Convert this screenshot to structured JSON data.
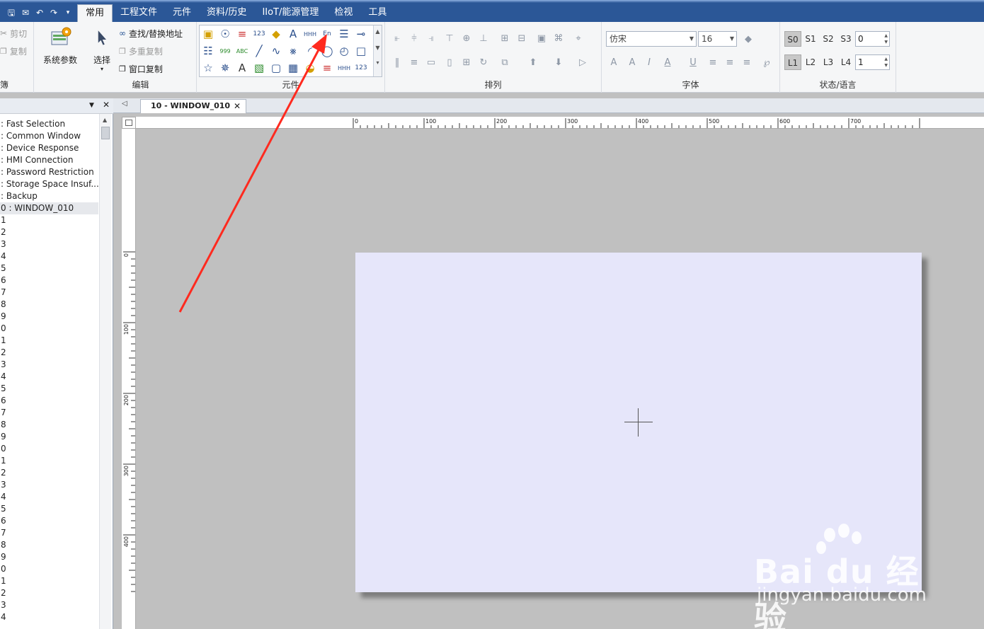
{
  "menu": {
    "tabs": [
      "常用",
      "工程文件",
      "元件",
      "资料/历史",
      "IIoT/能源管理",
      "检视",
      "工具"
    ],
    "active_index": 0
  },
  "ribbon": {
    "clipboard": {
      "cut": "剪切",
      "copy": "复制",
      "label": "簿"
    },
    "system_params": "系统参数",
    "select": "选择",
    "edit": {
      "find_replace": "查找/替换地址",
      "multi_copy": "多重复制",
      "window_copy": "窗口复制",
      "label": "编辑"
    },
    "elements_label": "元件",
    "arrange_label": "排列",
    "font": {
      "name": "仿宋",
      "size": "16",
      "label": "字体"
    },
    "state_lang": {
      "states": [
        "S0",
        "S1",
        "S2",
        "S3"
      ],
      "state_value": "0",
      "langs": [
        "L1",
        "L2",
        "L3",
        "L4"
      ],
      "lang_value": "1",
      "label": "状态/语言"
    }
  },
  "window_list": [
    ": Fast Selection",
    ": Common Window",
    ": Device Response",
    ": HMI Connection",
    ": Password Restriction",
    ": Storage Space Insuf...",
    ": Backup",
    "0 : WINDOW_010",
    "1",
    "2",
    "3",
    "4",
    "5",
    "6",
    "7",
    "8",
    "9",
    "0",
    "1",
    "2",
    "3",
    "4",
    "5",
    "6",
    "7",
    "8",
    "9",
    "0",
    "1",
    "2",
    "3",
    "4",
    "5",
    "6",
    "7",
    "8",
    "9",
    "0",
    "1",
    "2",
    "3",
    "4"
  ],
  "selected_window_index": 7,
  "doc_tab": {
    "title": "10 - WINDOW_010"
  },
  "ruler_h_labels": [
    "0",
    "100",
    "200",
    "300",
    "400",
    "500",
    "600",
    "700"
  ],
  "ruler_v_labels": [
    "0",
    "100",
    "200",
    "300",
    "400"
  ],
  "watermark": {
    "brand": "Bai  du 经验",
    "url": "jingyan.baidu.com"
  },
  "colors": {
    "menubar": "#2b5797",
    "canvas": "#e6e6fa",
    "workspace": "#c0c0c0",
    "annotation_arrow": "#ff2a1f"
  }
}
